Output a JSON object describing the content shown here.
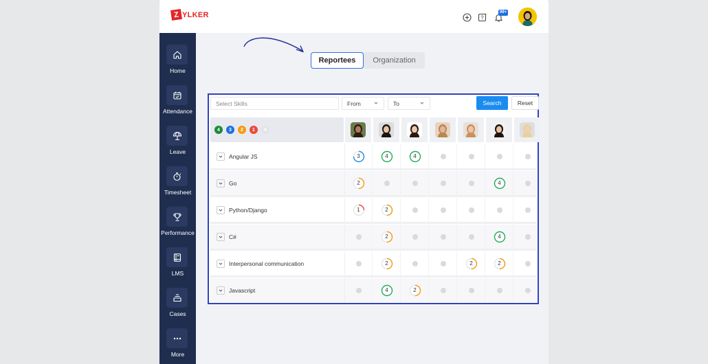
{
  "app": {
    "logo_mark": "Z",
    "logo_text": "YLKER",
    "notification_badge": "99+"
  },
  "sidebar": {
    "items": [
      {
        "label": "Home",
        "icon": "home-icon"
      },
      {
        "label": "Attendance",
        "icon": "calendar-check-icon"
      },
      {
        "label": "Leave",
        "icon": "umbrella-icon"
      },
      {
        "label": "Timesheet",
        "icon": "stopwatch-icon"
      },
      {
        "label": "Performance",
        "icon": "trophy-icon"
      },
      {
        "label": "LMS",
        "icon": "book-icon"
      },
      {
        "label": "Cases",
        "icon": "inbox-icon"
      },
      {
        "label": "More",
        "icon": "more-icon"
      }
    ]
  },
  "tabs": [
    {
      "label": "Reportees",
      "active": true
    },
    {
      "label": "Organization",
      "active": false
    }
  ],
  "filters": {
    "skills_placeholder": "Select Skills",
    "from_label": "From",
    "to_label": "To",
    "search_label": "Search",
    "reset_label": "Reset"
  },
  "legend": [
    {
      "value": "4",
      "color": "#1e8a3a"
    },
    {
      "value": "3",
      "color": "#1f6fe0"
    },
    {
      "value": "2",
      "color": "#f39c12"
    },
    {
      "value": "1",
      "color": "#e74c3c"
    },
    {
      "value": "0",
      "color": "#e3e4e8"
    }
  ],
  "employees": [
    {
      "skin": "#b07a5a",
      "hair": "#2a1d14",
      "bg": "#6b7a4a"
    },
    {
      "skin": "#e8c4a8",
      "hair": "#1e1510",
      "bg": "#dcdcdc"
    },
    {
      "skin": "#efc9ae",
      "hair": "#2b1a12",
      "bg": "#ffffff"
    },
    {
      "skin": "#e6b49a",
      "hair": "#b7884f",
      "bg": "#e8d3c0"
    },
    {
      "skin": "#f0c4a8",
      "hair": "#c8925a",
      "bg": "#e8e0da"
    },
    {
      "skin": "#e8c0a2",
      "hair": "#1e1410",
      "bg": "#f2f2f2"
    },
    {
      "skin": "#efd0b8",
      "hair": "#e7d29a",
      "bg": "#dedede"
    }
  ],
  "skills": [
    {
      "name": "Angular JS",
      "ratings": [
        3,
        4,
        4,
        0,
        0,
        0,
        0
      ]
    },
    {
      "name": "Go",
      "ratings": [
        2,
        0,
        0,
        0,
        0,
        4,
        0
      ]
    },
    {
      "name": "Python/Django",
      "ratings": [
        1,
        2,
        0,
        0,
        0,
        0,
        0
      ]
    },
    {
      "name": "C#",
      "ratings": [
        0,
        2,
        0,
        0,
        0,
        4,
        0
      ]
    },
    {
      "name": "Interpersonal communication",
      "ratings": [
        0,
        2,
        0,
        0,
        2,
        2,
        0
      ]
    },
    {
      "name": "Javascript",
      "ratings": [
        0,
        4,
        2,
        0,
        0,
        0,
        0
      ]
    }
  ],
  "rating_colors": {
    "1": "#e74c3c",
    "2": "#f39c12",
    "3": "#1f8ee6",
    "4": "#1fae5b"
  }
}
